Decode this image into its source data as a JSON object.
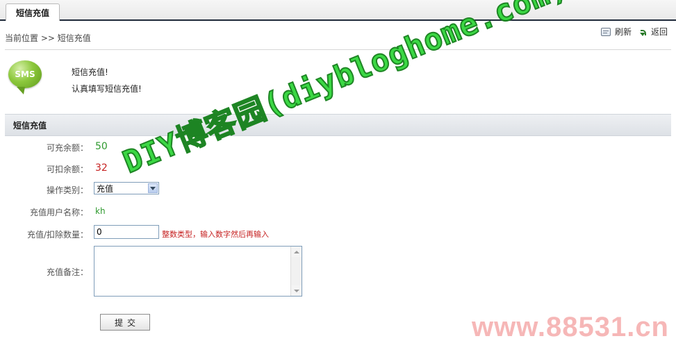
{
  "tab": {
    "label": "短信充值"
  },
  "breadcrumb": "当前位置  >> 短信充值",
  "actions": {
    "refresh": "刷新",
    "back": "返回"
  },
  "intro": {
    "icon_text": "SMS",
    "title": "短信充值!",
    "desc": "认真填写短信充值!"
  },
  "section": {
    "title": "短信充值"
  },
  "form": {
    "rechargeable_label": "可充余额：",
    "rechargeable_value": "50",
    "deductible_label": "可扣余额：",
    "deductible_value": "32",
    "operation_label": "操作类别：",
    "operation_selected": "充值",
    "user_label": "充值用户名称：",
    "user_value": "kh",
    "quantity_label": "充值/扣除数量：",
    "quantity_value": "0",
    "quantity_hint": "整数类型，输入数字然后再输入",
    "remark_label": "充值备注：",
    "remark_value": "",
    "submit_label": "提交"
  },
  "watermarks": {
    "main": "DIY博客园(diybloghome.com)",
    "bottom": "www.88531.cn"
  },
  "colors": {
    "accent_green": "#2f9a2f",
    "accent_red": "#c62222",
    "header_bar": "#dde1e6"
  }
}
